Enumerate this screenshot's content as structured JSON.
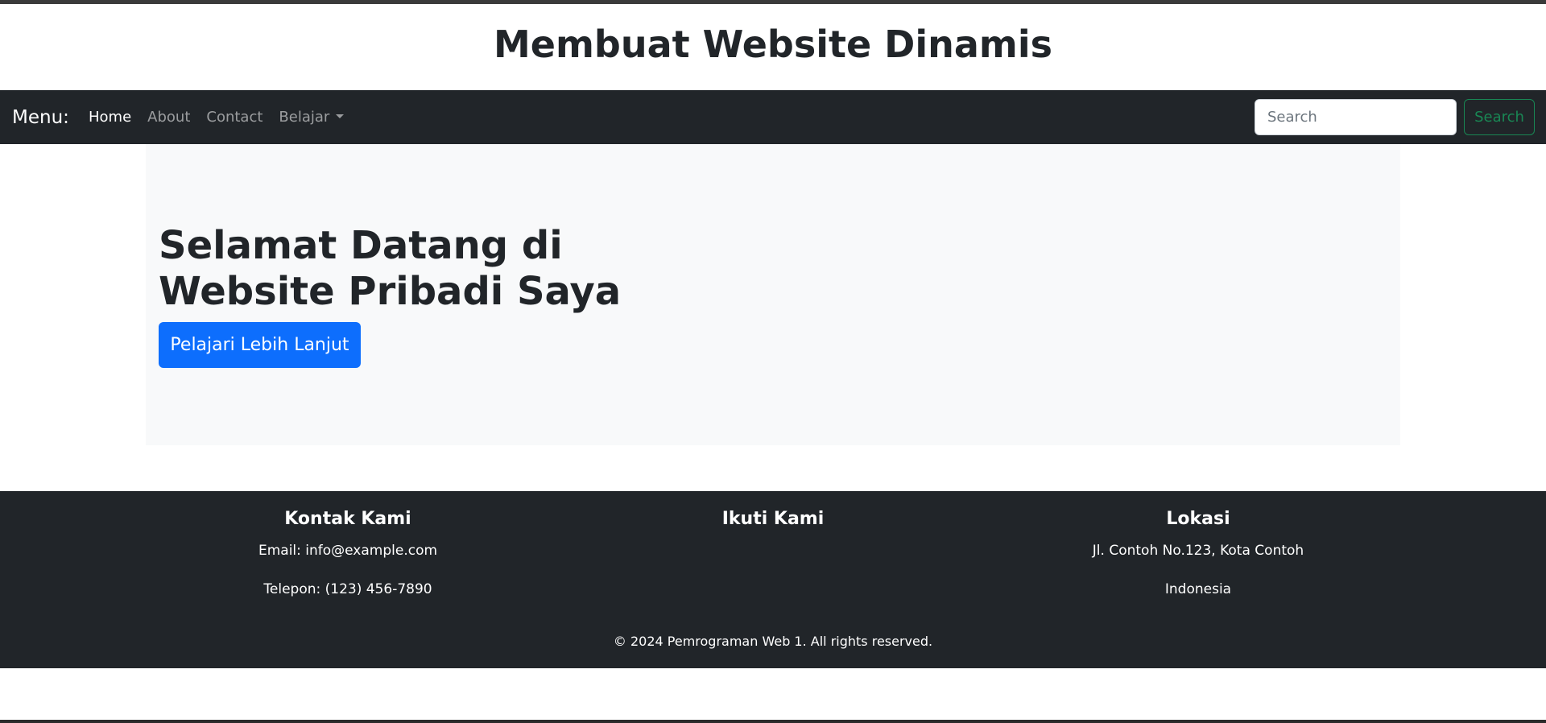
{
  "header": {
    "title": "Membuat Website Dinamis"
  },
  "navbar": {
    "brand": "Menu:",
    "links": [
      {
        "label": "Home",
        "active": true
      },
      {
        "label": "About",
        "active": false
      },
      {
        "label": "Contact",
        "active": false
      },
      {
        "label": "Belajar",
        "active": false,
        "dropdown": true
      }
    ],
    "search": {
      "placeholder": "Search",
      "value": "",
      "button_label": "Search"
    }
  },
  "hero": {
    "title": "Selamat Datang di Website Pribadi Saya",
    "button_label": "Pelajari Lebih Lanjut"
  },
  "footer": {
    "columns": [
      {
        "heading": "Kontak Kami",
        "lines": [
          "Email: info@example.com",
          "Telepon: (123) 456-7890"
        ]
      },
      {
        "heading": "Ikuti Kami",
        "lines": []
      },
      {
        "heading": "Lokasi",
        "lines": [
          "Jl. Contoh No.123, Kota Contoh",
          "Indonesia"
        ]
      }
    ],
    "copyright": "© 2024 Pemrograman Web 1. All rights reserved."
  },
  "colors": {
    "navbar_bg": "#212529",
    "hero_bg": "#f8f9fa",
    "primary": "#0d6efd",
    "success": "#198754"
  },
  "icons": [
    "dropdown-caret-icon"
  ]
}
